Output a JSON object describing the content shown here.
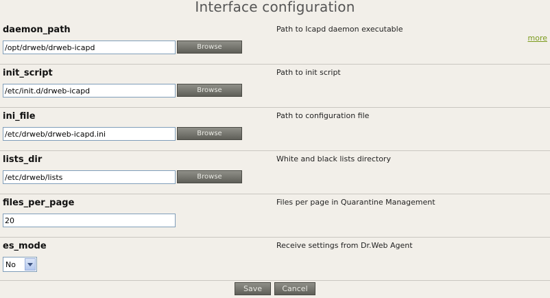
{
  "page": {
    "title": "Interface configuration"
  },
  "params": {
    "daemon_path": {
      "name": "daemon_path",
      "description": "Path to Icapd daemon executable",
      "value": "/opt/drweb/drweb-icapd",
      "browse_label": "Browse",
      "more_label": "more"
    },
    "init_script": {
      "name": "init_script",
      "description": "Path to init script",
      "value": "/etc/init.d/drweb-icapd",
      "browse_label": "Browse"
    },
    "ini_file": {
      "name": "ini_file",
      "description": "Path to configuration file",
      "value": "/etc/drweb/drweb-icapd.ini",
      "browse_label": "Browse"
    },
    "lists_dir": {
      "name": "lists_dir",
      "description": "White and black lists directory",
      "value": "/etc/drweb/lists",
      "browse_label": "Browse"
    },
    "files_per_page": {
      "name": "files_per_page",
      "description": "Files per page in Quarantine Management",
      "value": "20"
    },
    "es_mode": {
      "name": "es_mode",
      "description": "Receive settings from Dr.Web Agent",
      "selected": "No"
    }
  },
  "footer": {
    "save_label": "Save",
    "cancel_label": "Cancel"
  },
  "colors": {
    "background": "#f2efe9",
    "button": "#7a7a73",
    "link": "#7a9a1a",
    "divider": "#c9c6c0"
  }
}
